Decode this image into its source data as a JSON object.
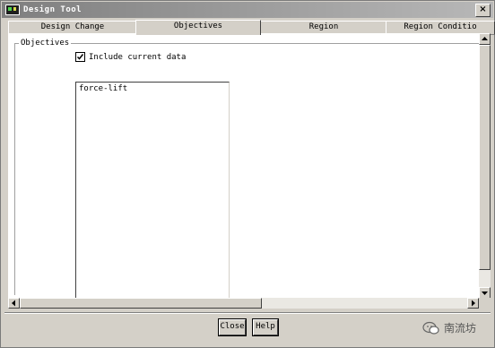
{
  "window": {
    "title": "Design Tool",
    "close_glyph": "×"
  },
  "tabs": [
    {
      "label": "Design Change",
      "active": false
    },
    {
      "label": "Objectives",
      "active": true
    },
    {
      "label": "Region",
      "active": false
    },
    {
      "label": "Region Conditio",
      "active": false
    }
  ],
  "objectives": {
    "group_label": "Objectives",
    "include_current_data": {
      "label": "Include current data",
      "checked": true
    },
    "list_items": [
      "force-lift"
    ]
  },
  "footer": {
    "close_label": "Close",
    "help_label": "Help"
  },
  "watermark": {
    "text": "南流坊"
  },
  "colors": {
    "chrome": "#d4d0c8",
    "titlebar": "#7f7f7f",
    "panel": "#ffffff"
  }
}
